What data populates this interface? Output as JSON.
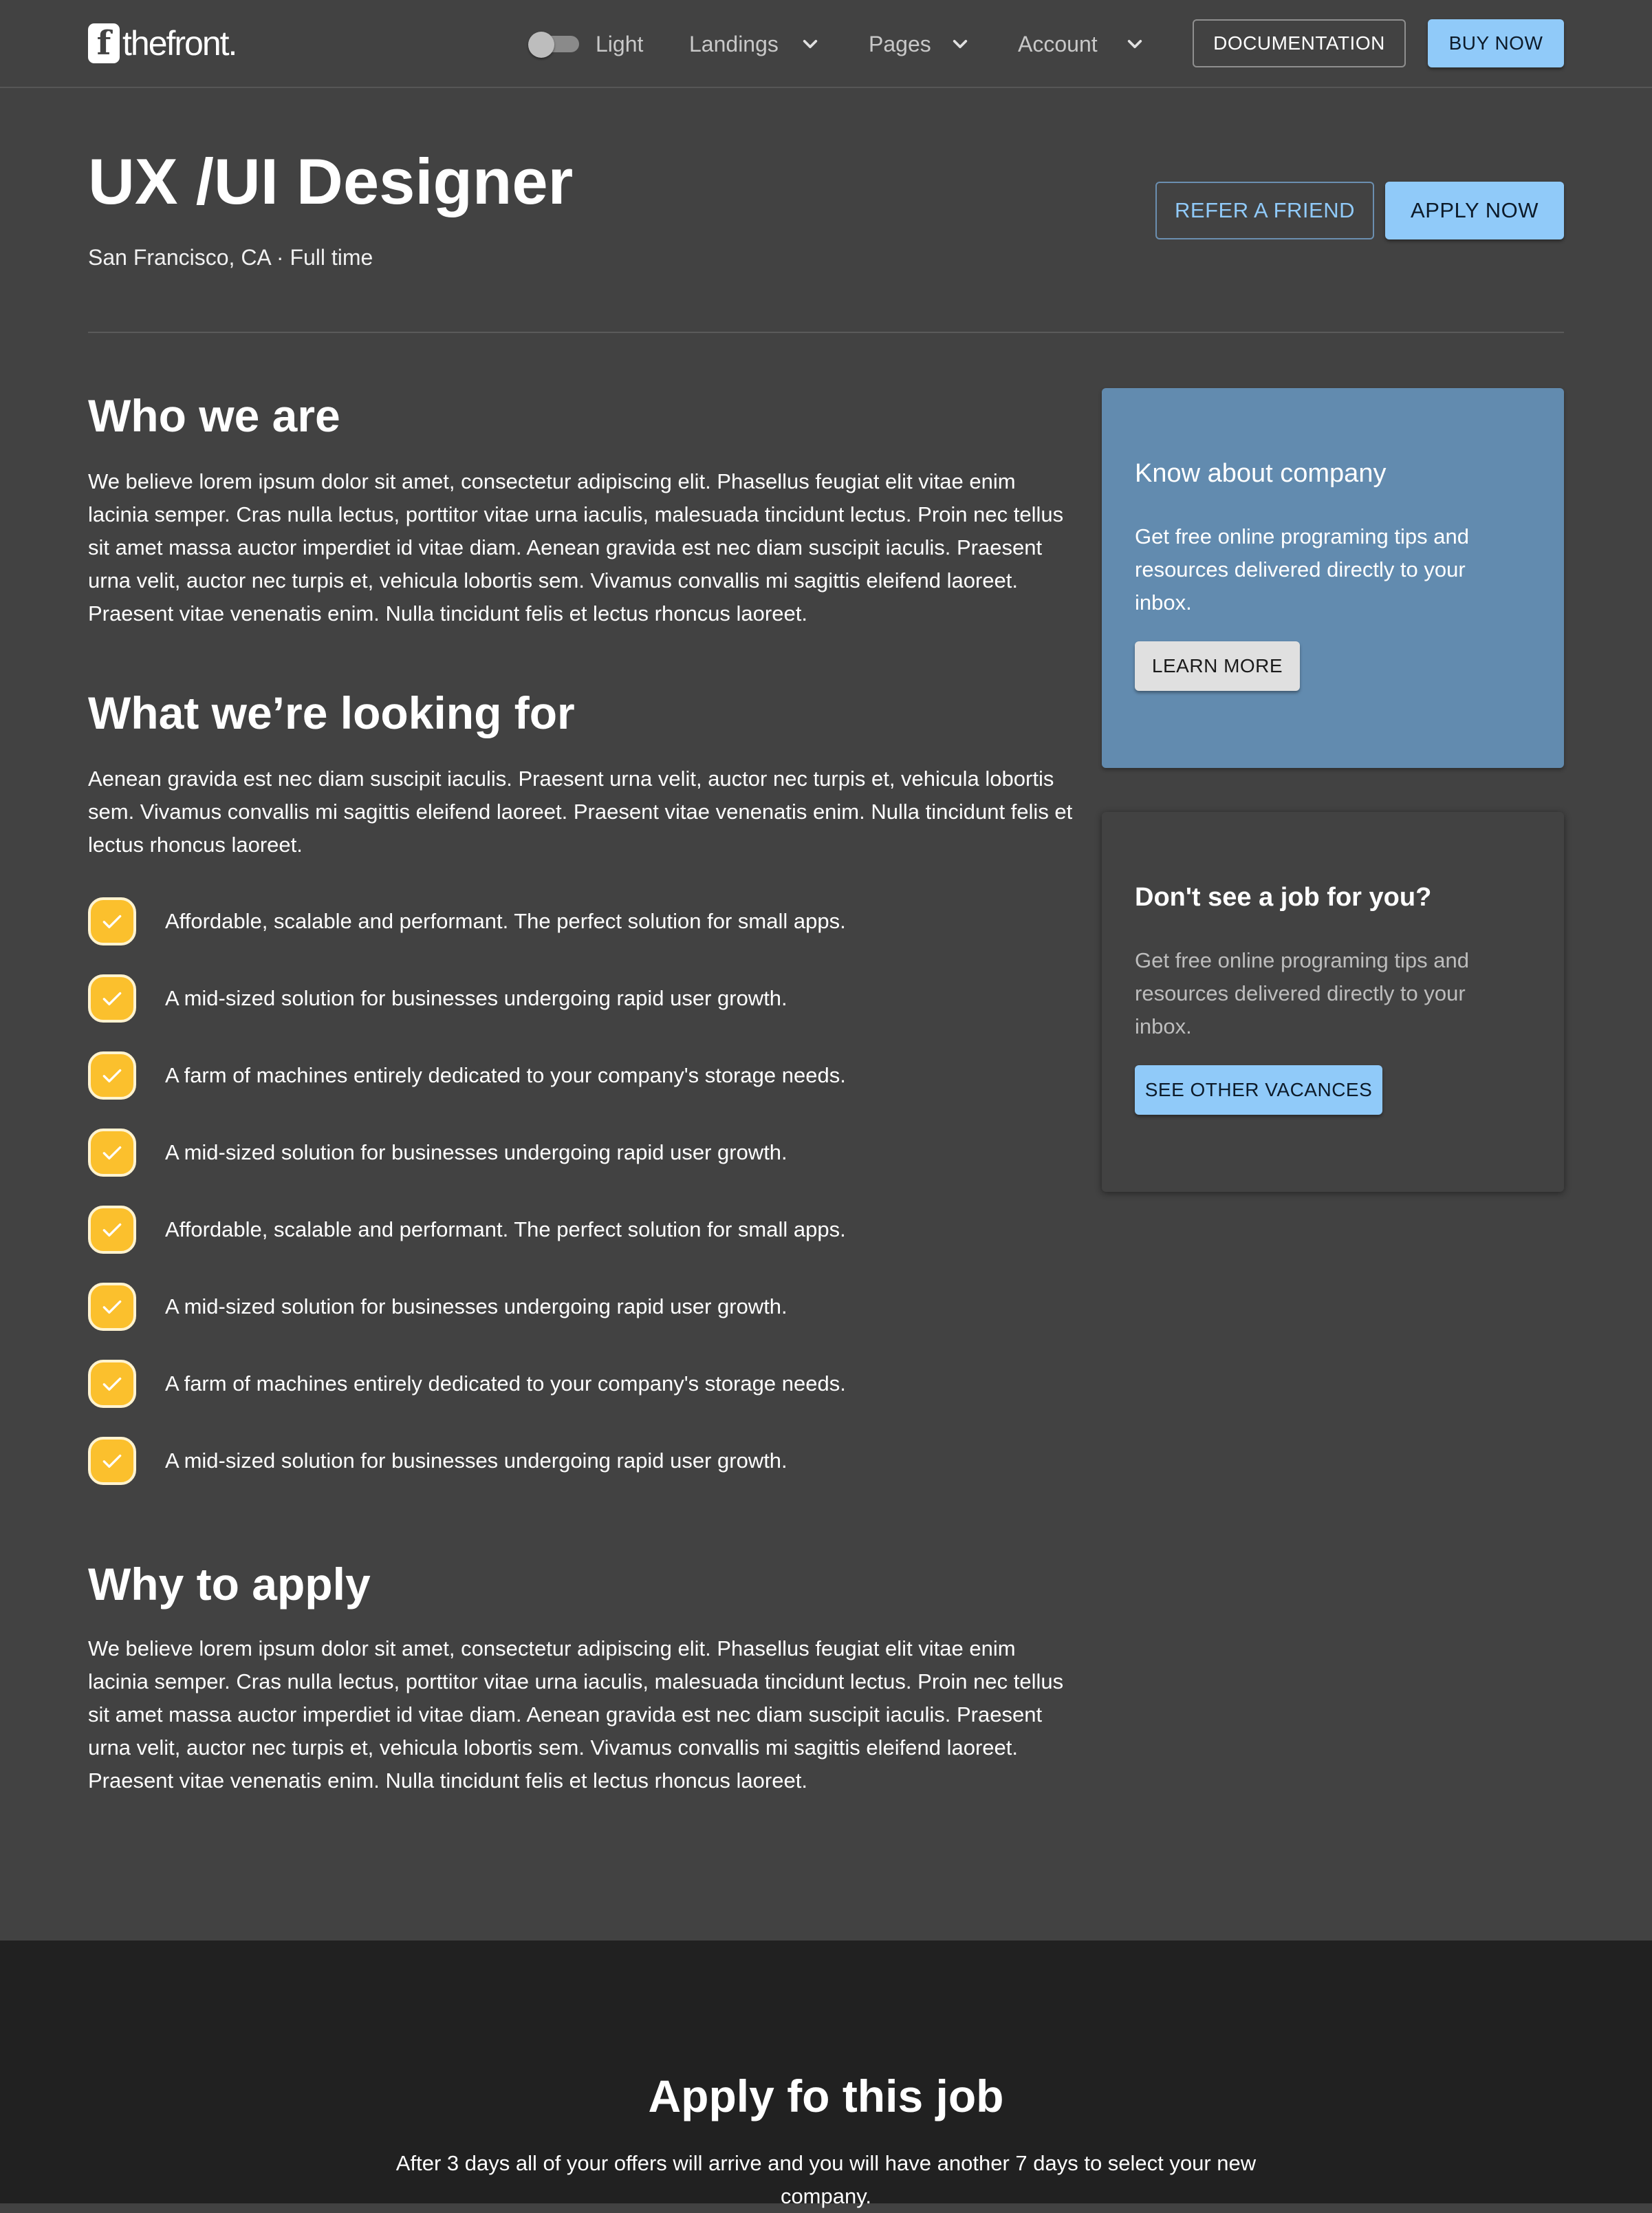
{
  "header": {
    "logo_letter": "f",
    "logo_text": "thefront.",
    "theme_label": "Light",
    "nav": [
      {
        "label": "Landings"
      },
      {
        "label": "Pages"
      },
      {
        "label": "Account"
      }
    ],
    "documentation_label": "DOCUMENTATION",
    "buy_label": "BUY NOW"
  },
  "job": {
    "title": "UX /UI Designer",
    "meta": "San Francisco, CA · Full time",
    "refer_label": "REFER A FRIEND",
    "apply_label": "APPLY NOW"
  },
  "sections": {
    "who": {
      "title": "Who we are",
      "text": "We believe lorem ipsum dolor sit amet, consectetur adipiscing elit. Phasellus feugiat elit vitae enim lacinia semper. Cras nulla lectus, porttitor vitae urna iaculis, malesuada tincidunt lectus. Proin nec tellus sit amet massa auctor imperdiet id vitae diam. Aenean gravida est nec diam suscipit iaculis. Praesent urna velit, auctor nec turpis et, vehicula lobortis sem. Vivamus convallis mi sagittis eleifend laoreet. Praesent vitae venenatis enim. Nulla tincidunt felis et lectus rhoncus laoreet."
    },
    "looking": {
      "title": "What we’re looking for",
      "text": "Aenean gravida est nec diam suscipit iaculis. Praesent urna velit, auctor nec turpis et, vehicula lobortis sem. Vivamus convallis mi sagittis eleifend laoreet. Praesent vitae venenatis enim. Nulla tincidunt felis et lectus rhoncus laoreet.",
      "items": [
        "Affordable, scalable and performant. The perfect solution for small apps.",
        "A mid-sized solution for businesses undergoing rapid user growth.",
        "A farm of machines entirely dedicated to your company's storage needs.",
        "A mid-sized solution for businesses undergoing rapid user growth.",
        "Affordable, scalable and performant. The perfect solution for small apps.",
        "A mid-sized solution for businesses undergoing rapid user growth.",
        "A farm of machines entirely dedicated to your company's storage needs.",
        "A mid-sized solution for businesses undergoing rapid user growth."
      ]
    },
    "why": {
      "title": "Why to apply",
      "text": "We believe lorem ipsum dolor sit amet, consectetur adipiscing elit. Phasellus feugiat elit vitae enim lacinia semper. Cras nulla lectus, porttitor vitae urna iaculis, malesuada tincidunt lectus. Proin nec tellus sit amet massa auctor imperdiet id vitae diam. Aenean gravida est nec diam suscipit iaculis. Praesent urna velit, auctor nec turpis et, vehicula lobortis sem. Vivamus convallis mi sagittis eleifend laoreet. Praesent vitae venenatis enim. Nulla tincidunt felis et lectus rhoncus laoreet."
    }
  },
  "sidebar": {
    "company": {
      "title": "Know about company",
      "text": "Get free online programing tips and resources delivered directly to your inbox.",
      "button": "LEARN MORE"
    },
    "other": {
      "title": "Don't see a job for you?",
      "text": "Get free online programing tips and resources delivered directly to your inbox.",
      "button": "SEE OTHER VACANCES"
    }
  },
  "cta": {
    "title": "Apply fo this job",
    "text": "After 3 days all of your offers will arrive and you will have another 7 days to select your new company."
  },
  "colors": {
    "background": "#424242",
    "accent": "#90caf9",
    "check": "#fbc02d",
    "company_card": "#628baf",
    "footer": "#212121"
  }
}
